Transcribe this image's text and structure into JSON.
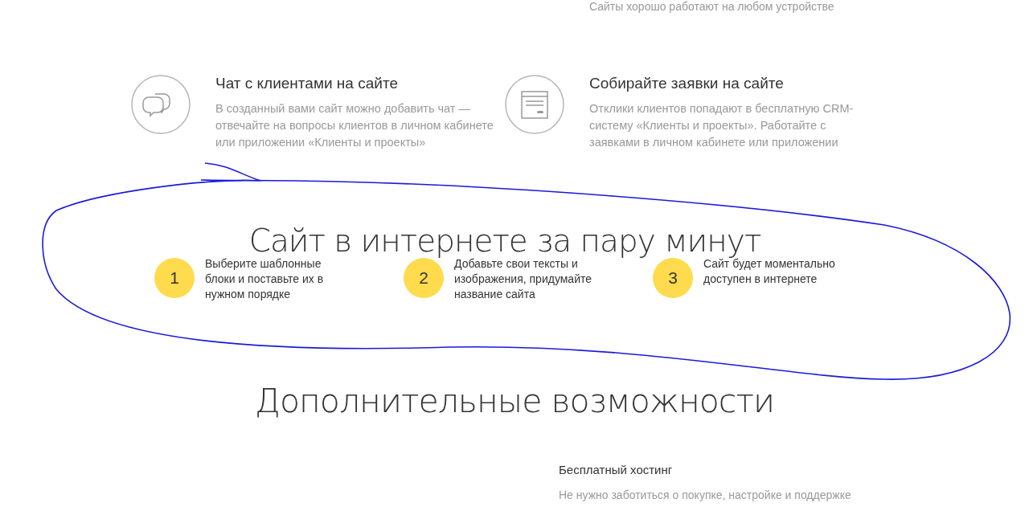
{
  "top_caption": "Сайты хорошо работают на любом устройстве",
  "features": [
    {
      "title": "Чат с клиентами на сайте",
      "text": "В созданный вами сайт можно добавить чат — отвечайте на вопросы клиентов в личном кабинете или приложении «Клиенты и проекты»"
    },
    {
      "title": "Собирайте заявки на сайте",
      "text": "Отклики клиентов попадают в бесплатную CRM-систему «Клиенты и проекты». Работайте с заявками в личном кабинете или приложении"
    }
  ],
  "steps_section": {
    "heading": "Сайт в интернете за пару минут",
    "steps": [
      {
        "number": "1",
        "text": "Выберите шаблонные блоки и поставьте их в нужном порядке"
      },
      {
        "number": "2",
        "text": "Добавьте свои тексты и изображения, придумайте название сайта"
      },
      {
        "number": "3",
        "text": "Сайт будет моментально доступен в интернете"
      }
    ]
  },
  "extras_section": {
    "heading": "Дополнительные возможности",
    "items": [
      {
        "title": "Бесплатный хостинг",
        "text": "Не нужно заботиться о покупке, настройке и поддержке"
      }
    ]
  }
}
